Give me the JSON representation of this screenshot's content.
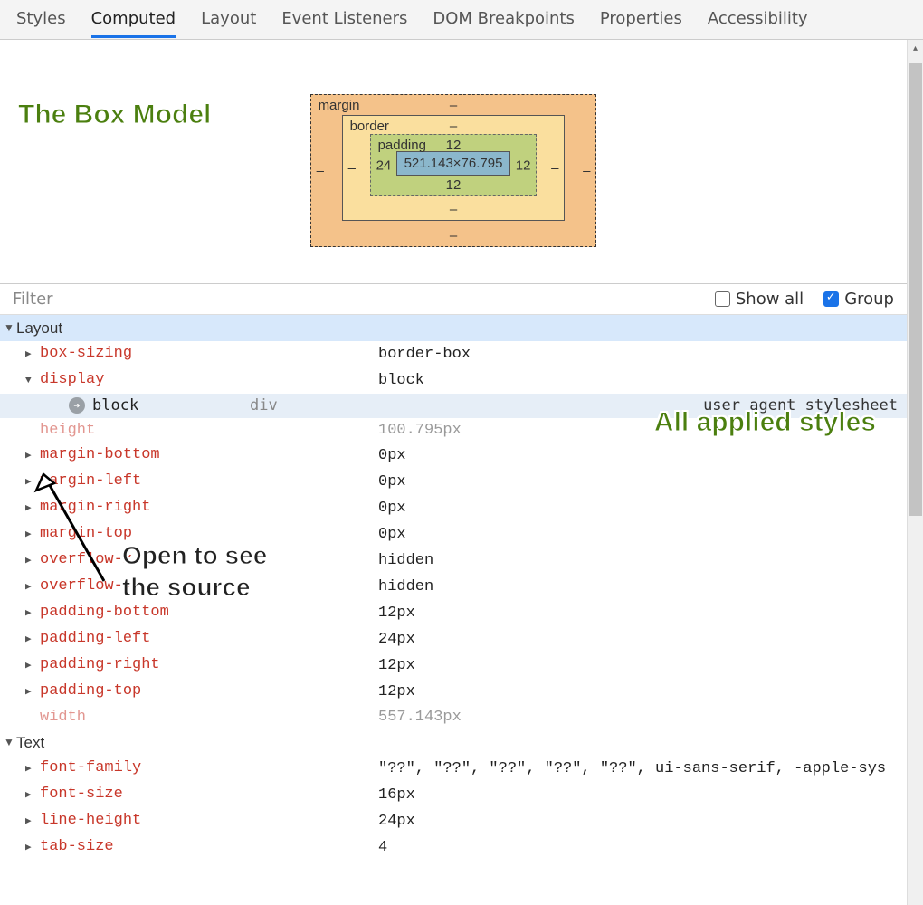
{
  "tabs": [
    "Styles",
    "Computed",
    "Layout",
    "Event Listeners",
    "DOM Breakpoints",
    "Properties",
    "Accessibility"
  ],
  "active_tab_index": 1,
  "annotations": {
    "box_model": "The Box Model",
    "applied": "All applied styles",
    "open_source": "Open to see\nthe source"
  },
  "box_model": {
    "margin": {
      "label": "margin",
      "top": "–",
      "right": "–",
      "bottom": "–",
      "left": "–"
    },
    "border": {
      "label": "border",
      "top": "–",
      "right": "–",
      "bottom": "–",
      "left": "–"
    },
    "padding": {
      "label": "padding",
      "top": "12",
      "right": "12",
      "bottom": "12",
      "left": "24"
    },
    "content": "521.143×76.795"
  },
  "filter": {
    "placeholder": "Filter",
    "show_all_label": "Show all",
    "show_all_checked": false,
    "group_label": "Group",
    "group_checked": true
  },
  "groups": [
    {
      "name": "Layout",
      "highlight": true,
      "rows": [
        {
          "name": "box-sizing",
          "value": "border-box",
          "expandable": true
        },
        {
          "name": "display",
          "value": "block",
          "expandable": true,
          "expanded": true,
          "sub": {
            "value": "block",
            "selector": "div",
            "source": "user agent stylesheet"
          }
        },
        {
          "name": "height",
          "value": "100.795px",
          "dim": true
        },
        {
          "name": "margin-bottom",
          "value": "0px",
          "expandable": true
        },
        {
          "name": "margin-left",
          "value": "0px",
          "expandable": true
        },
        {
          "name": "margin-right",
          "value": "0px",
          "expandable": true
        },
        {
          "name": "margin-top",
          "value": "0px",
          "expandable": true
        },
        {
          "name": "overflow-x",
          "value": "hidden",
          "expandable": true
        },
        {
          "name": "overflow-y",
          "value": "hidden",
          "expandable": true
        },
        {
          "name": "padding-bottom",
          "value": "12px",
          "expandable": true
        },
        {
          "name": "padding-left",
          "value": "24px",
          "expandable": true
        },
        {
          "name": "padding-right",
          "value": "12px",
          "expandable": true
        },
        {
          "name": "padding-top",
          "value": "12px",
          "expandable": true
        },
        {
          "name": "width",
          "value": "557.143px",
          "dim": true
        }
      ]
    },
    {
      "name": "Text",
      "highlight": false,
      "rows": [
        {
          "name": "font-family",
          "value": "\"??\", \"??\", \"??\", \"??\", \"??\", ui-sans-serif, -apple-sys",
          "expandable": true
        },
        {
          "name": "font-size",
          "value": "16px",
          "expandable": true
        },
        {
          "name": "line-height",
          "value": "24px",
          "expandable": true
        },
        {
          "name": "tab-size",
          "value": "4",
          "expandable": true
        }
      ]
    }
  ]
}
